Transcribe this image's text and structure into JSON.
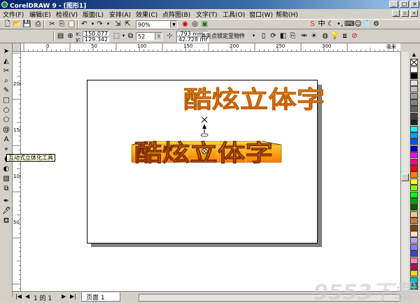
{
  "window": {
    "title": "CorelDRAW 9 - [图形1]",
    "minimize": "_",
    "maximize": "□",
    "close": "×"
  },
  "menu": [
    {
      "label": "文件(F)"
    },
    {
      "label": "编辑(E)"
    },
    {
      "label": "检视(V)"
    },
    {
      "label": "版面(L)"
    },
    {
      "label": "安排(A)"
    },
    {
      "label": "效果(C)"
    },
    {
      "label": "点阵图(B)"
    },
    {
      "label": "文字(T)"
    },
    {
      "label": "工具(O)"
    },
    {
      "label": "窗口(W)"
    },
    {
      "label": "帮助(H)"
    }
  ],
  "toolbar": {
    "zoom_value": "90%"
  },
  "property_bar": {
    "x_label": "x:",
    "x_value": "150.077",
    "y_label": "y:",
    "y_value": "129.342",
    "depth_value": "52",
    "vp_x": ".793 mm",
    "vp_y": "42.728 mm",
    "vanishing_point": "消失点锁定至物件"
  },
  "ruler": {
    "unit": "毫米",
    "h_labels": [
      "0",
      "50",
      "100",
      "150",
      "200",
      "250",
      "300"
    ],
    "v_labels": [
      "200",
      "150",
      "100",
      "50"
    ]
  },
  "artwork": {
    "text": "酷炫立体字",
    "colors": {
      "face_top": "#f5a623",
      "face_bottom": "#e8501c",
      "extrude_top": "#fdd835",
      "extrude_bottom": "#f57c00"
    }
  },
  "tooltip": "互动式立体化工具",
  "status": {
    "page_of": "1 的 1",
    "page_tab": "页面 1"
  },
  "palette": [
    "#ffffff",
    "#000000",
    "#e0e0e0",
    "#c0c0c0",
    "#a0a0a0",
    "#808080",
    "#606060",
    "#404040",
    "#202020",
    "#00ffff",
    "#00a0ff",
    "#0050ff",
    "#0000c0",
    "#ff00ff",
    "#ff0080",
    "#ff0000",
    "#ff8000",
    "#ffff00",
    "#80ff00",
    "#00ff00",
    "#00a000",
    "#006000",
    "#ffc080",
    "#c08040",
    "#804000",
    "#ffe0c0",
    "#c0a0ff",
    "#8080ff",
    "#4040c0",
    "#ff80c0",
    "#c00060",
    "#ffd700",
    "#00c0c0",
    "#008080"
  ],
  "watermark": "9553下载"
}
